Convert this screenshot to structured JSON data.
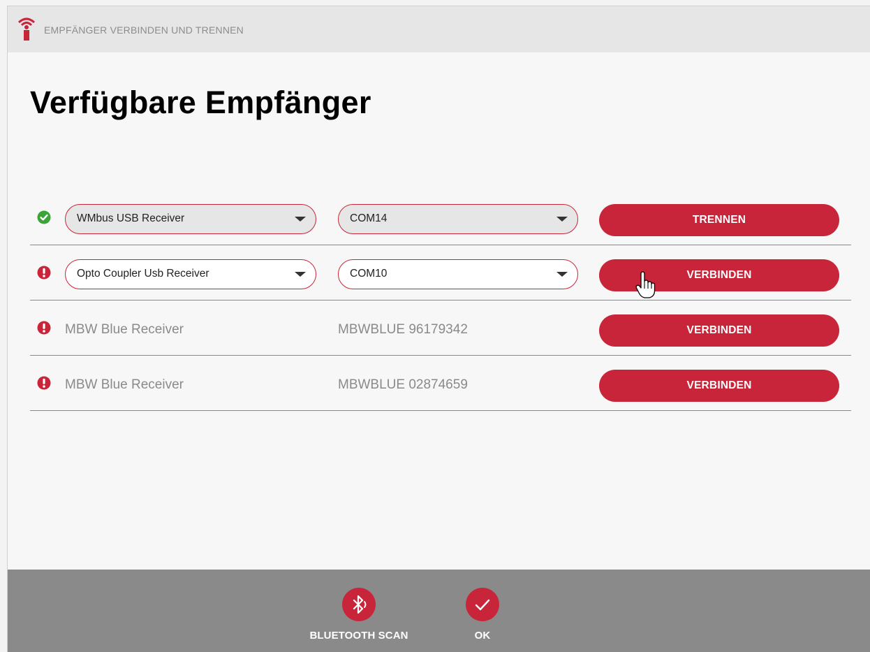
{
  "window": {
    "title": "EMPFÄNGER VERBINDEN UND TRENNEN"
  },
  "page": {
    "title": "Verfügbare Empfänger"
  },
  "receivers": [
    {
      "status": "connected",
      "status_icon": "check-circle-icon",
      "name": "WMbus USB Receiver",
      "port": "COM14",
      "action": "TRENNEN"
    },
    {
      "status": "error",
      "status_icon": "exclamation-circle-icon",
      "name": "Opto Coupler Usb Receiver",
      "port": "COM10",
      "action": "VERBINDEN"
    },
    {
      "status": "error",
      "status_icon": "exclamation-circle-icon",
      "name": "MBW Blue Receiver",
      "port": "MBWBLUE 96179342",
      "action": "VERBINDEN"
    },
    {
      "status": "error",
      "status_icon": "exclamation-circle-icon",
      "name": "MBW Blue Receiver",
      "port": "MBWBLUE 02874659",
      "action": "VERBINDEN"
    }
  ],
  "footer": {
    "bluetooth_scan_label": "BLUETOOTH SCAN",
    "ok_label": "OK"
  },
  "colors": {
    "accent": "#c8253a",
    "ok_green": "#3aa536",
    "footer_bg": "#8a8a8a"
  }
}
